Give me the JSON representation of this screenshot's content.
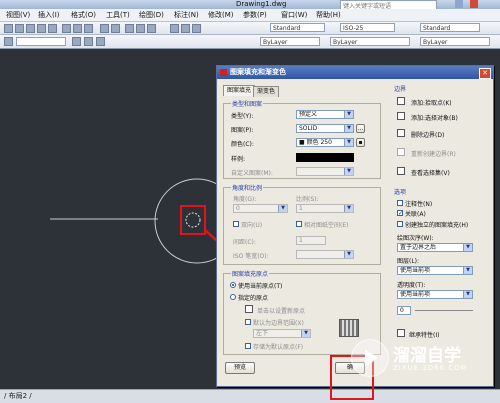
{
  "window": {
    "title": "Drawing1.dwg",
    "search_placeholder": "键入关键字或短语"
  },
  "menu": [
    "视图(V)",
    "插入(I)",
    "格式(O)",
    "工具(T)",
    "绘图(D)",
    "标注(N)",
    "修改(M)",
    "参数(P)",
    "窗口(W)",
    "帮助(H)"
  ],
  "toolbar": {
    "style1": "Standard",
    "style2": "ISO-25",
    "style3": "Standard",
    "layer1": "ByLayer",
    "layer2": "ByLayer",
    "layer3": "ByLayer"
  },
  "canvas": {
    "circle_diameter_text": ""
  },
  "status": {
    "layout_tab": "/ 布局2 /"
  },
  "dialog": {
    "title": "图案填充和渐变色",
    "tabs": [
      "图案填充",
      "渐变色"
    ],
    "type_group": {
      "label": "类型和图案",
      "type_label": "类型(Y):",
      "type_value": "预定义",
      "pattern_label": "图案(P):",
      "pattern_value": "SOLID",
      "color_label": "颜色(C):",
      "color_value": "■ 颜色 250",
      "sample_label": "样例:",
      "custom_label": "自定义图案(M):"
    },
    "angle_group": {
      "label": "角度和比例",
      "angle_label": "角度(G):",
      "angle_value": "0",
      "scale_label": "比例(S):",
      "scale_value": "1",
      "double_label": "双向(U)",
      "relative_label": "相对图纸空间(E)",
      "spacing_label": "间距(C):",
      "spacing_value": "1",
      "iso_label": "ISO 笔宽(O):"
    },
    "origin_group": {
      "label": "图案填充原点",
      "current_label": "使用当前原点(T)",
      "specified_label": "指定的原点",
      "click_label": "单击以设置新原点",
      "default_label": "默认为边界范围(X)",
      "default_value": "左下",
      "store_label": "存储为默认原点(F)"
    },
    "boundary": {
      "label": "边界",
      "add_pick": "添加:拾取点(K)",
      "add_select": "添加:选择对象(B)",
      "remove": "删除边界(D)",
      "recreate": "重新创建边界(R)",
      "view": "查看选择集(V)"
    },
    "options": {
      "label": "选项",
      "annotative": "注释性(N)",
      "associative": "关联(A)",
      "separate": "创建独立的图案填充(H)",
      "draw_order_label": "绘图次序(W):",
      "draw_order_value": "置于边界之后",
      "layer_label": "图层(L):",
      "layer_value": "使用当前项",
      "transparency_label": "透明度(T):",
      "transparency_value": "使用当前项",
      "transparency_num": "0",
      "inherit": "继承特性(I)"
    },
    "buttons": {
      "preview": "预览",
      "ok": "确"
    }
  },
  "watermark": {
    "brand": "溜溜自学",
    "url": "ZIXUE.3D66.COM"
  }
}
